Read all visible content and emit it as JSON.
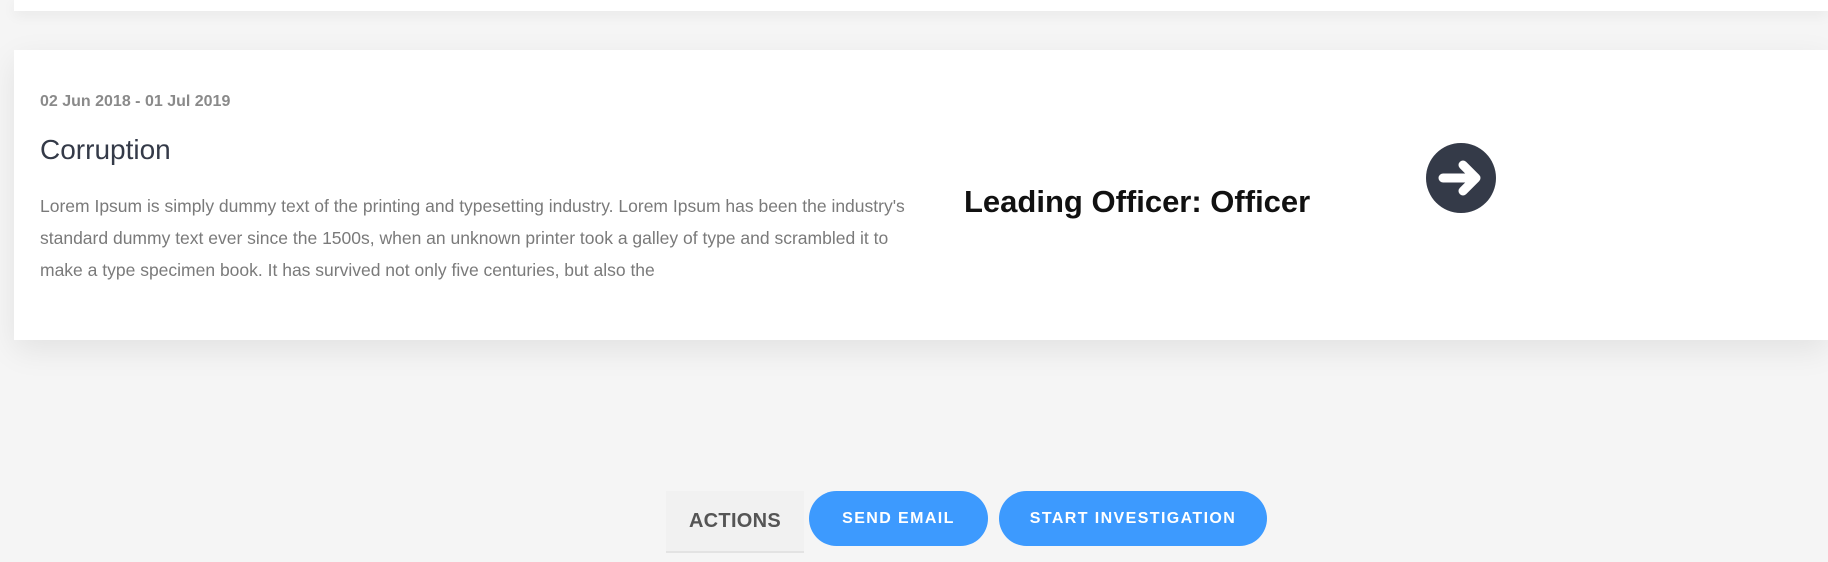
{
  "case": {
    "dates": "02 Jun 2018 - 01 Jul 2019",
    "title": "Corruption",
    "description": "Lorem Ipsum is simply dummy text of the printing and typesetting industry. Lorem Ipsum has been the industry's standard dummy text ever since the 1500s, when an unknown printer took a galley of type and scrambled it to make a type specimen book. It has survived not only five centuries, but also the",
    "leading_officer": "Leading Officer: Officer",
    "open_icon": "arrow-circle-right-icon"
  },
  "actions": {
    "label": "ACTIONS",
    "send_email_label": "SEND EMAIL",
    "start_investigation_label": "START INVESTIGATION"
  },
  "colors": {
    "page_background": "#f5f5f5",
    "card_background": "#ffffff",
    "title": "#343a48",
    "muted_text": "#7a7a7a",
    "accent": "#3d9afe",
    "icon_dark": "#343a48"
  }
}
